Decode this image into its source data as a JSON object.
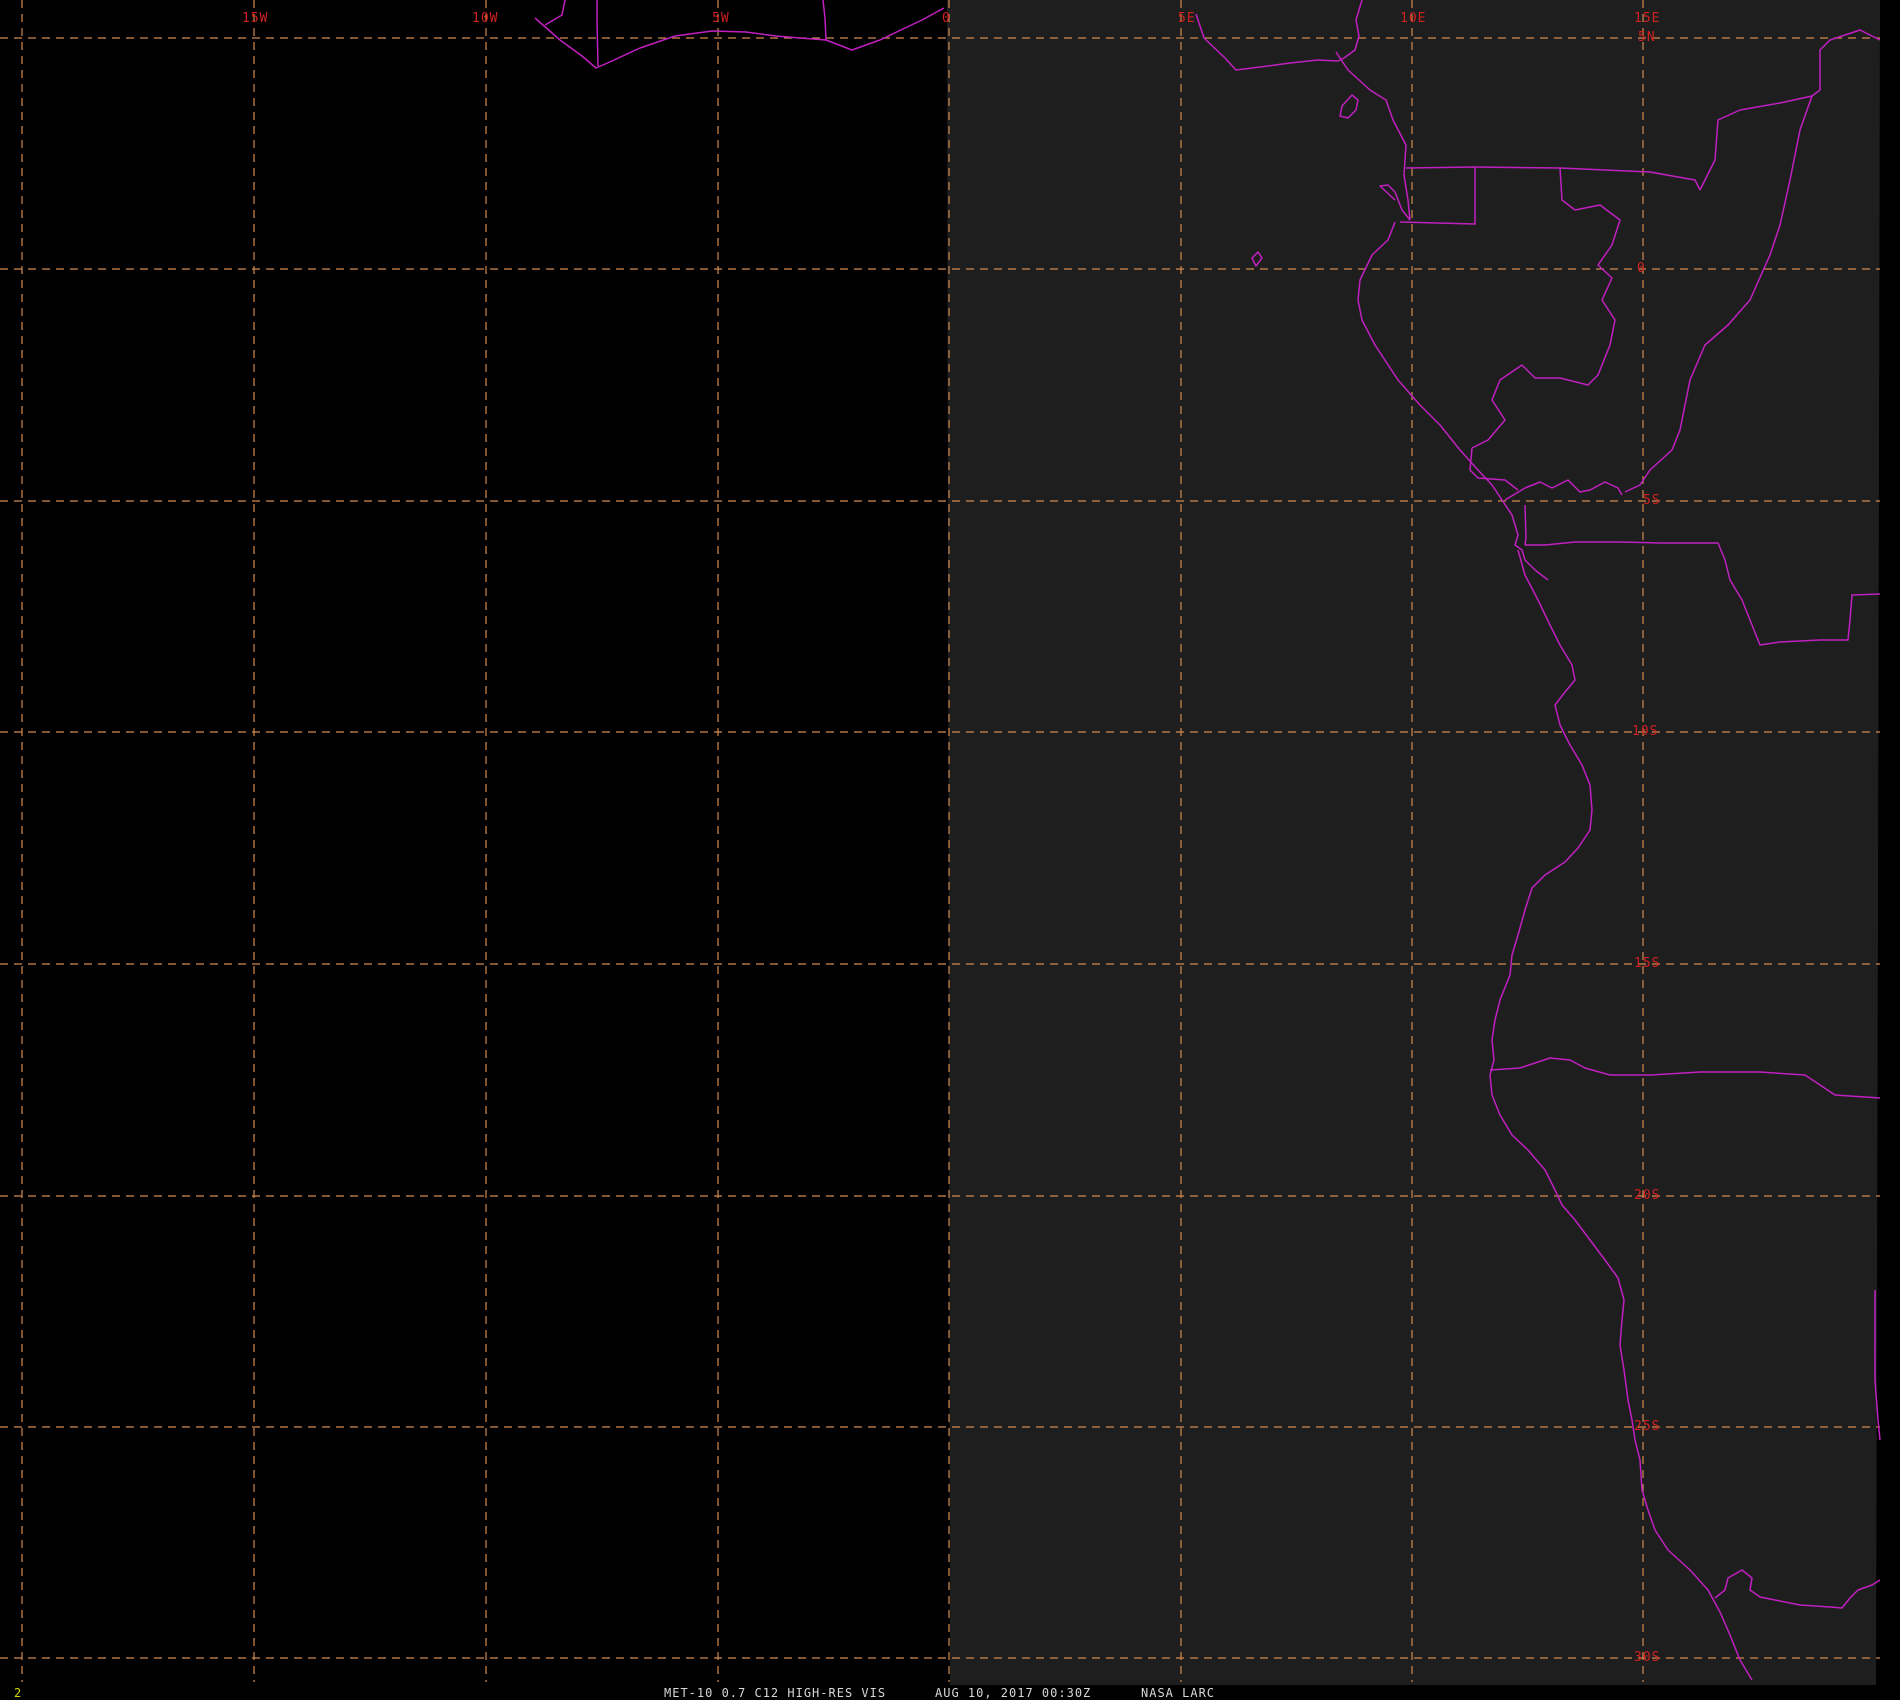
{
  "colors": {
    "background": "#000000",
    "imagery": "#1e1e1e",
    "grid": "#d08a50",
    "grid_label": "#d02020",
    "coastline": "#c020c0",
    "footer_text": "#d8d8d8",
    "frame_number": "#d8d800"
  },
  "grid": {
    "longitude_labels": [
      "15W",
      "10W",
      "5W",
      "0",
      "5E",
      "10E",
      "15E"
    ],
    "latitude_labels": [
      "5N",
      "0",
      "5S",
      "10S",
      "15S",
      "20S",
      "25S",
      "30S"
    ]
  },
  "footer": {
    "frame_number": "2",
    "satellite": "MET-10 0.7 C12 HIGH-RES VIS",
    "datetime": "AUG 10, 2017 00:30Z",
    "credit": "NASA LARC"
  },
  "icons": {
    "coastline": "coastline-overlay",
    "borders": "country-border-overlay"
  }
}
